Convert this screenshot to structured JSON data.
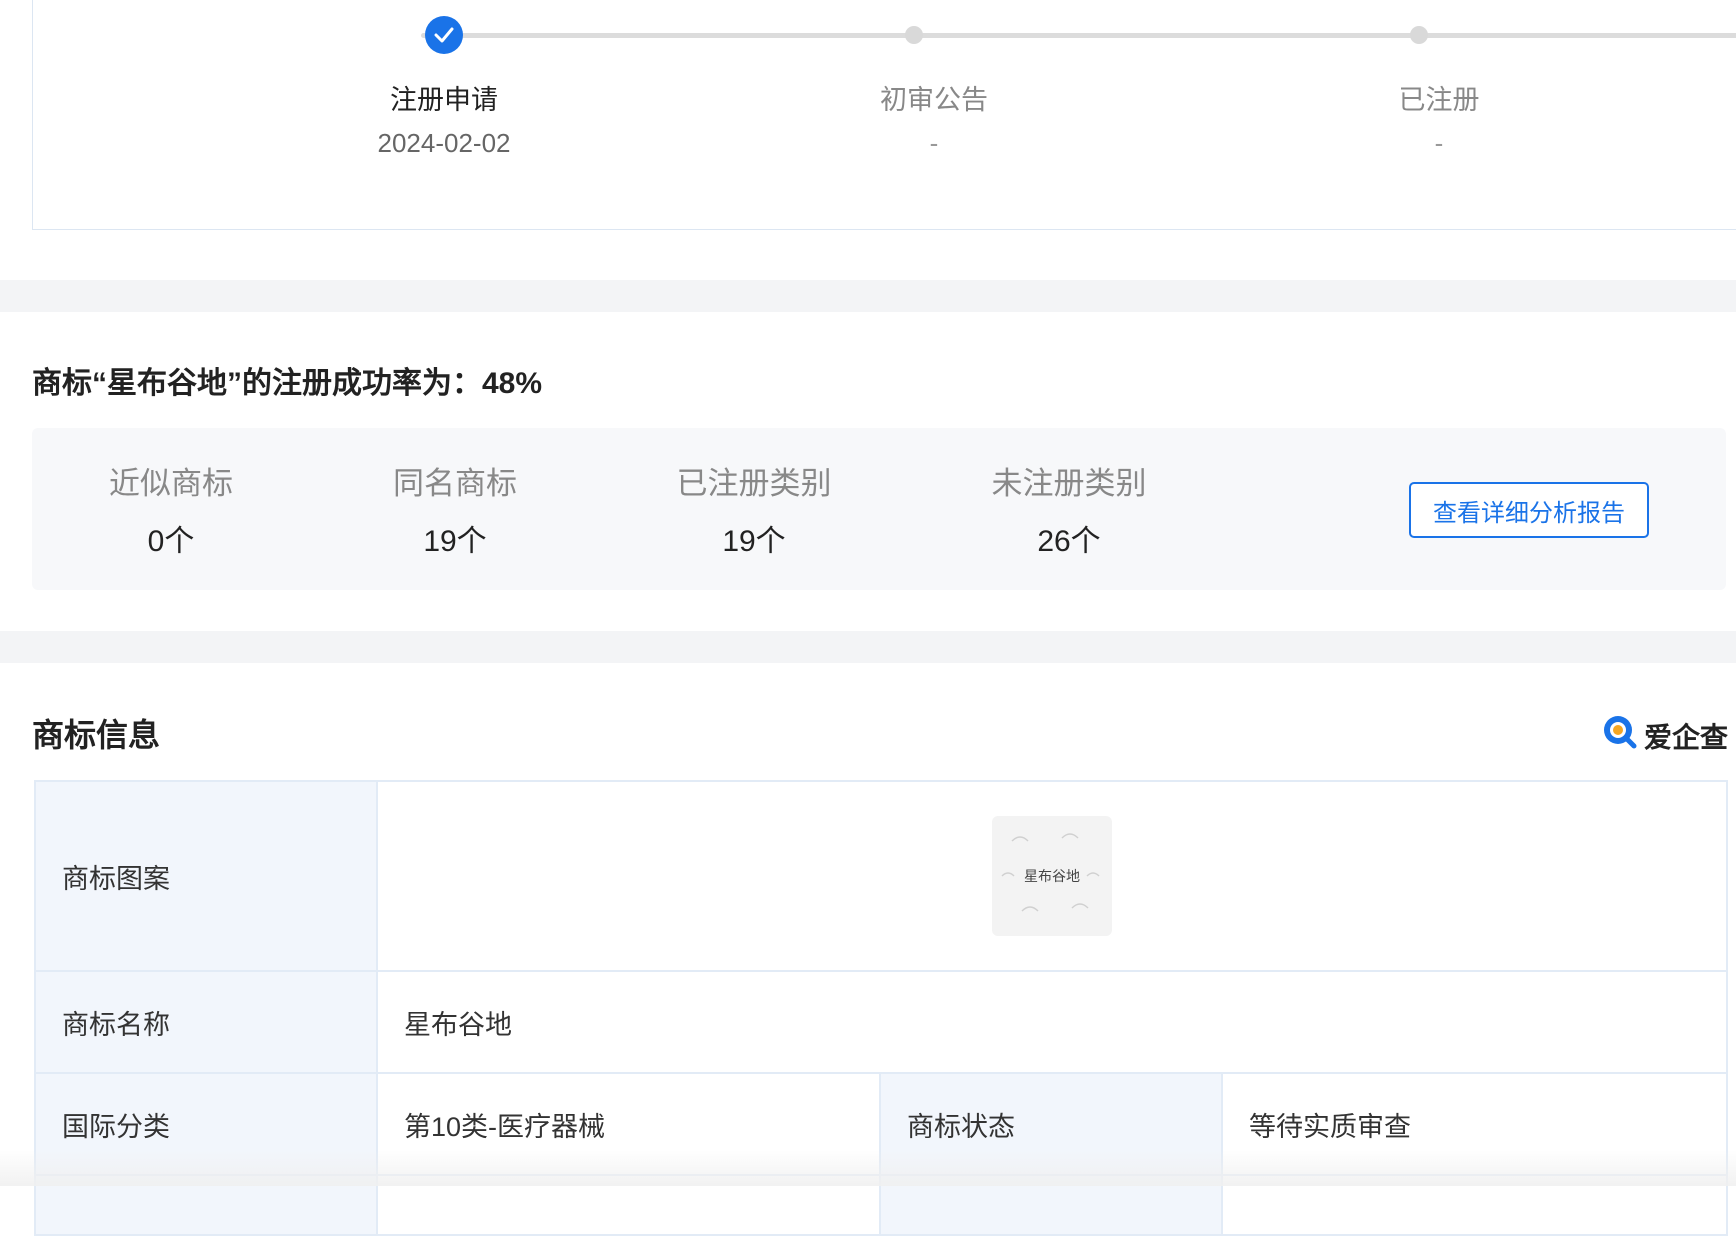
{
  "progress": {
    "steps": [
      {
        "label": "注册申请",
        "date": "2024-02-02",
        "done": true
      },
      {
        "label": "初审公告",
        "date": "-",
        "done": false
      },
      {
        "label": "已注册",
        "date": "-",
        "done": false
      }
    ]
  },
  "success_rate": {
    "title": "商标“星布谷地”的注册成功率为：48%",
    "stats": [
      {
        "label": "近似商标",
        "value": "0个"
      },
      {
        "label": "同名商标",
        "value": "19个"
      },
      {
        "label": "已注册类别",
        "value": "19个"
      },
      {
        "label": "未注册类别",
        "value": "26个"
      }
    ],
    "report_button": "查看详细分析报告"
  },
  "trademark_info": {
    "title": "商标信息",
    "brand": "爱企查",
    "logo_text": "星布谷地",
    "rows": {
      "image_label": "商标图案",
      "name_label": "商标名称",
      "name_value": "星布谷地",
      "class_label": "国际分类",
      "class_value": "第10类-医疗器械",
      "status_label": "商标状态",
      "status_value": "等待实质审查"
    }
  },
  "colors": {
    "accent": "#1a73e8",
    "border": "#e2ebf6",
    "key_bg": "#f2f6fc",
    "band": "#f3f4f6"
  }
}
